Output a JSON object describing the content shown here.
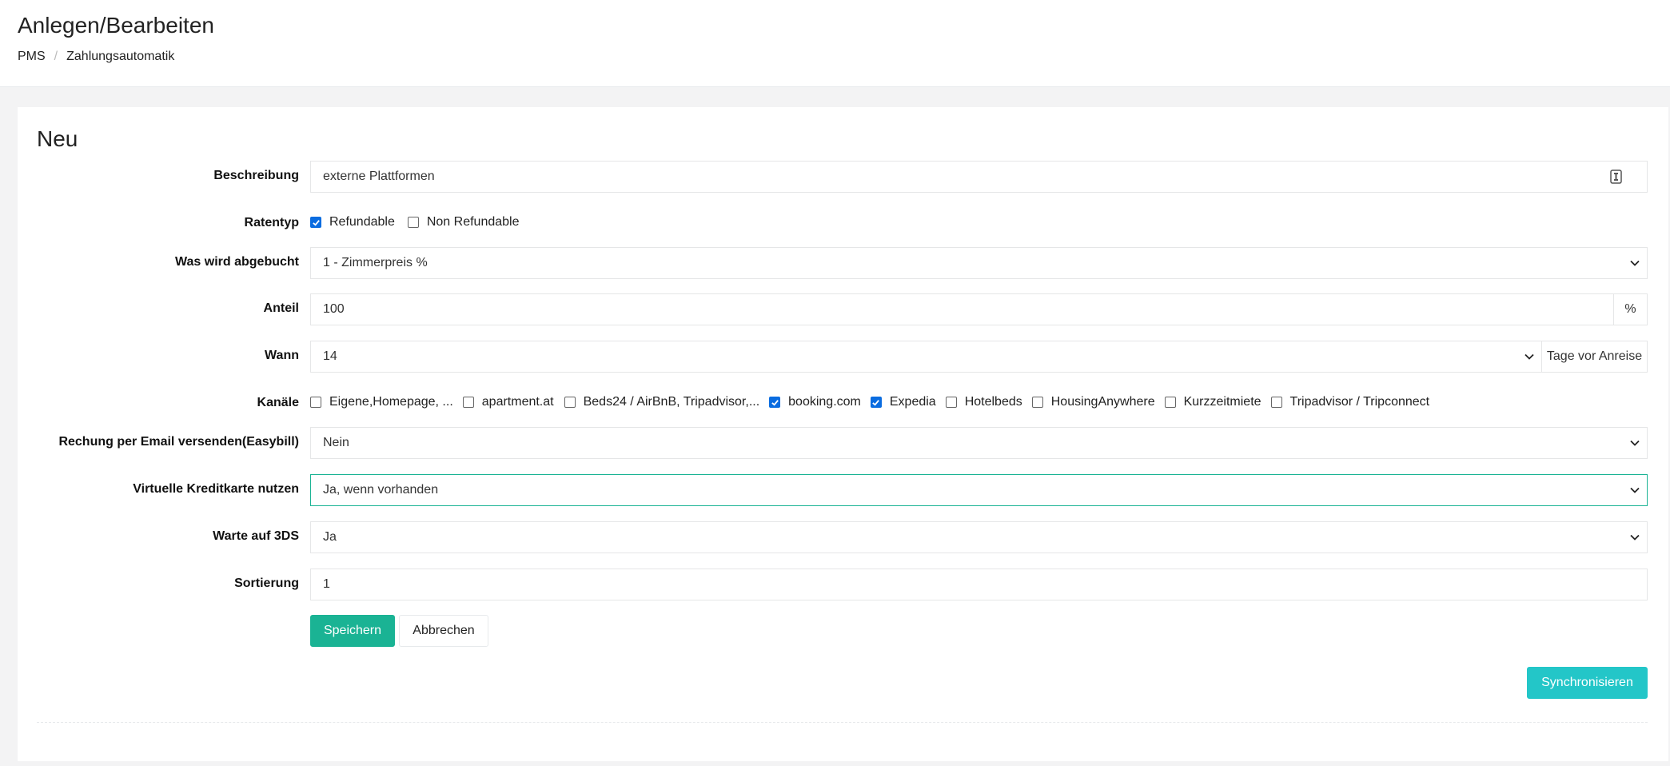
{
  "header": {
    "title": "Anlegen/Bearbeiten",
    "breadcrumb": [
      "PMS",
      "Zahlungsautomatik"
    ],
    "breadcrumb_separator": "/"
  },
  "form": {
    "title": "Neu",
    "beschreibung": {
      "label": "Beschreibung",
      "value": "externe Plattformen"
    },
    "ratentyp": {
      "label": "Ratentyp",
      "options": [
        {
          "label": "Refundable",
          "checked": true
        },
        {
          "label": "Non Refundable",
          "checked": false
        }
      ]
    },
    "abgebucht": {
      "label": "Was wird abgebucht",
      "value": "1 - Zimmerpreis %"
    },
    "anteil": {
      "label": "Anteil",
      "value": "100",
      "addon": "%"
    },
    "wann": {
      "label": "Wann",
      "value": "14",
      "addon": "Tage vor Anreise"
    },
    "kanaele": {
      "label": "Kanäle",
      "options": [
        {
          "label": "Eigene,Homepage, ...",
          "checked": false
        },
        {
          "label": "apartment.at",
          "checked": false
        },
        {
          "label": "Beds24 / AirBnB, Tripadvisor,...",
          "checked": false
        },
        {
          "label": "booking.com",
          "checked": true
        },
        {
          "label": "Expedia",
          "checked": true
        },
        {
          "label": "Hotelbeds",
          "checked": false
        },
        {
          "label": "HousingAnywhere",
          "checked": false
        },
        {
          "label": "Kurzzeitmiete",
          "checked": false
        },
        {
          "label": "Tripadvisor / Tripconnect",
          "checked": false
        }
      ]
    },
    "email": {
      "label": "Rechung per Email versenden(Easybill)",
      "value": "Nein"
    },
    "kreditkarte": {
      "label": "Virtuelle Kreditkarte nutzen",
      "value": "Ja, wenn vorhanden"
    },
    "dreids": {
      "label": "Warte auf 3DS",
      "value": "Ja"
    },
    "sortierung": {
      "label": "Sortierung",
      "value": "1"
    },
    "buttons": {
      "save": "Speichern",
      "cancel": "Abbrechen",
      "sync": "Synchronisieren"
    }
  },
  "colors": {
    "primary": "#1ab394",
    "info": "#23c6c8",
    "checkbox": "#0a6ce0"
  }
}
